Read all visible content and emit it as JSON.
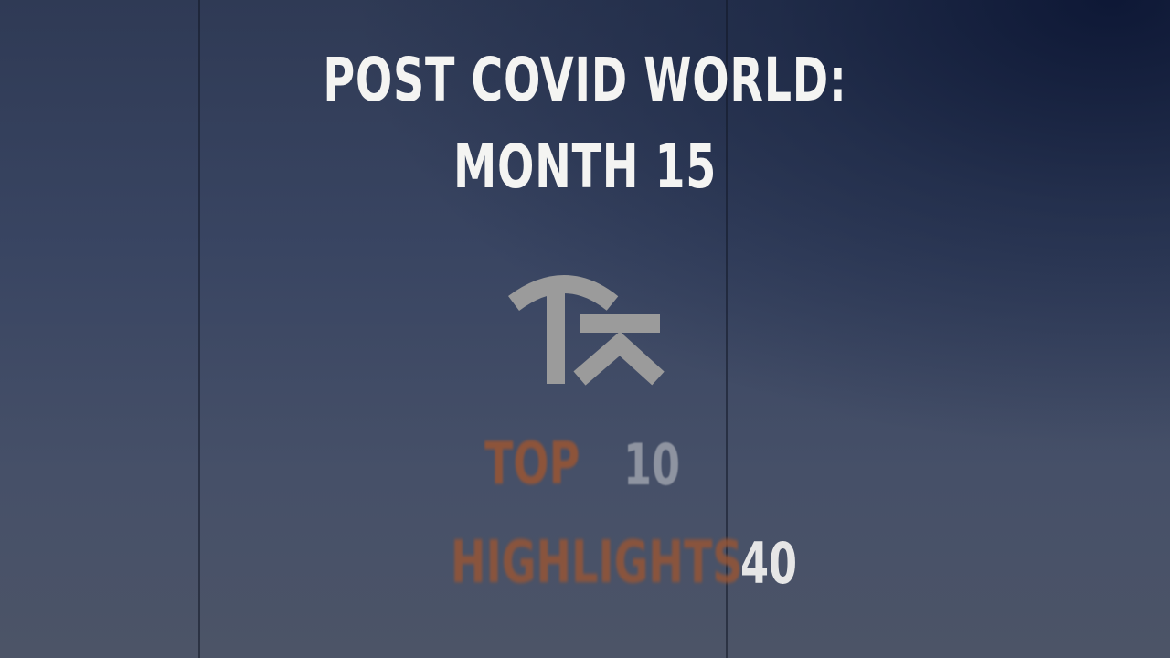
{
  "title": {
    "line1": "POST COVID WORLD:",
    "line2": "MONTH 15"
  },
  "logo": {
    "icon": "fnatic-logo-icon",
    "color": "#9b9b9b"
  },
  "ranking": {
    "top_label": "TOP",
    "top_number": "10",
    "highlights_label": "HIGHLIGHTS",
    "highlights_number": "40"
  },
  "colors": {
    "accent_orange": "#9a5533",
    "title_text": "#f4f4f2"
  }
}
